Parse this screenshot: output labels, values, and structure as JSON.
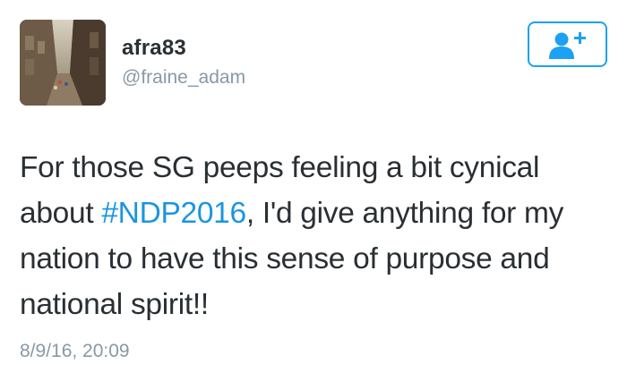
{
  "user": {
    "display_name": "afra83",
    "handle": "@fraine_adam",
    "avatar_icon": "profile-photo"
  },
  "follow_button": {
    "icon": "add-user-icon",
    "accent_color": "#1da1f2"
  },
  "tweet": {
    "text_before": "For those SG peeps feeling a bit cynical about ",
    "hashtag": "#NDP2016",
    "text_after": ", I'd give anything for my nation to have this sense of purpose and national spirit!!",
    "timestamp": "8/9/16, 20:09"
  },
  "colors": {
    "text": "#292f33",
    "muted": "#8899a6",
    "link": "#1b95e0"
  }
}
